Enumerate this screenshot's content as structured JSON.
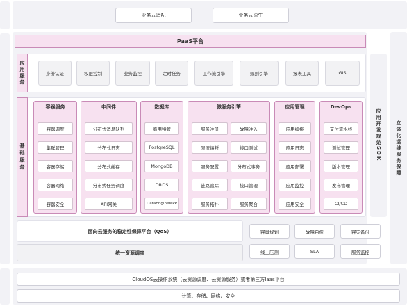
{
  "top": {
    "items": [
      "业务云适配",
      "业务云原生"
    ]
  },
  "paas": {
    "title": "PaaS平台"
  },
  "app_services": {
    "label": "应用服务",
    "items": [
      "身份认证",
      "权限控制",
      "业务监控",
      "定时任务",
      "工作流引擎",
      "规则引擎",
      "报表工具",
      "GIS"
    ]
  },
  "base_services": {
    "label": "基础服务",
    "columns": [
      {
        "title": "容器服务",
        "items": [
          "容器调度",
          "集群管理",
          "容器存储",
          "容器网络",
          "容器安全"
        ]
      },
      {
        "title": "中间件",
        "items": [
          "分布式消息队列",
          "分布式日志",
          "分布式缓存",
          "分布式任务调度",
          "API网关"
        ]
      },
      {
        "title": "数据库",
        "items": [
          "商用特管",
          "PostgreSQL",
          "MongoDB",
          "DRDS",
          "DataEngineMPP"
        ]
      },
      {
        "title": "微服务引擎",
        "pairs": [
          [
            "服务注册",
            "故障注入"
          ],
          [
            "限流熔断",
            "接口测试"
          ],
          [
            "服务配置",
            "分布式事务"
          ],
          [
            "链路追踪",
            "接口管理"
          ],
          [
            "服务拓扑",
            "服务聚合"
          ]
        ]
      },
      {
        "title": "应用管理",
        "items": [
          "应用编排",
          "应用日志",
          "应用部署",
          "应用监控",
          "应用安全"
        ]
      },
      {
        "title": "DevOps",
        "items": [
          "交付流水线",
          "测试管理",
          "版本管理",
          "发布管理",
          "CI/CD"
        ]
      }
    ]
  },
  "sdk": {
    "label": "应用开发规范SDK"
  },
  "right_side": {
    "label": "立体化运维服务保障"
  },
  "qos": {
    "title": "面向云服务的稳定性保障平台（QoS）",
    "scheduler": "统一资源调度",
    "items": [
      "容量规划",
      "故障自愈",
      "容灾备份",
      "线上压测",
      "SLA",
      "服务监控"
    ]
  },
  "bottom": {
    "os": "CloudOS云操作系统（云资源调度、云资源服务）或者第三方Iaas平台",
    "infra": "计算、存储、网络、安全"
  }
}
